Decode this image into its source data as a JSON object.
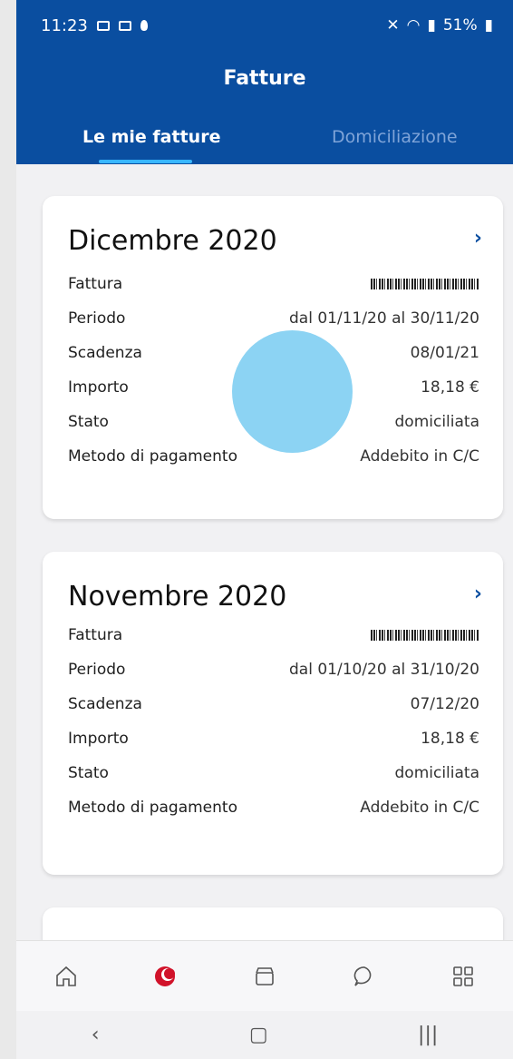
{
  "status_bar": {
    "time": "11:23",
    "battery": "51%"
  },
  "header": {
    "title": "Fatture"
  },
  "tabs": [
    {
      "label": "Le mie fatture"
    },
    {
      "label": "Domiciliazione"
    }
  ],
  "invoices": [
    {
      "month": "Dicembre 2020",
      "rows": [
        {
          "label": "Fattura",
          "value": ""
        },
        {
          "label": "Periodo",
          "value": "dal 01/11/20 al 30/11/20"
        },
        {
          "label": "Scadenza",
          "value": "08/01/21"
        },
        {
          "label": "Importo",
          "value": "18,18 €"
        },
        {
          "label": "Stato",
          "value": "domiciliata"
        },
        {
          "label": "Metodo di pagamento",
          "value": "Addebito in C/C"
        }
      ]
    },
    {
      "month": "Novembre 2020",
      "rows": [
        {
          "label": "Fattura",
          "value": ""
        },
        {
          "label": "Periodo",
          "value": "dal 01/10/20 al 31/10/20"
        },
        {
          "label": "Scadenza",
          "value": "07/12/20"
        },
        {
          "label": "Importo",
          "value": "18,18 €"
        },
        {
          "label": "Stato",
          "value": "domiciliata"
        },
        {
          "label": "Metodo di pagamento",
          "value": "Addebito in C/C"
        }
      ]
    }
  ],
  "bottom_nav": [
    "home-icon",
    "brand-icon",
    "shop-icon",
    "chat-icon",
    "apps-icon"
  ],
  "system_nav": [
    "back-icon",
    "home-circle-icon",
    "recents-icon"
  ]
}
